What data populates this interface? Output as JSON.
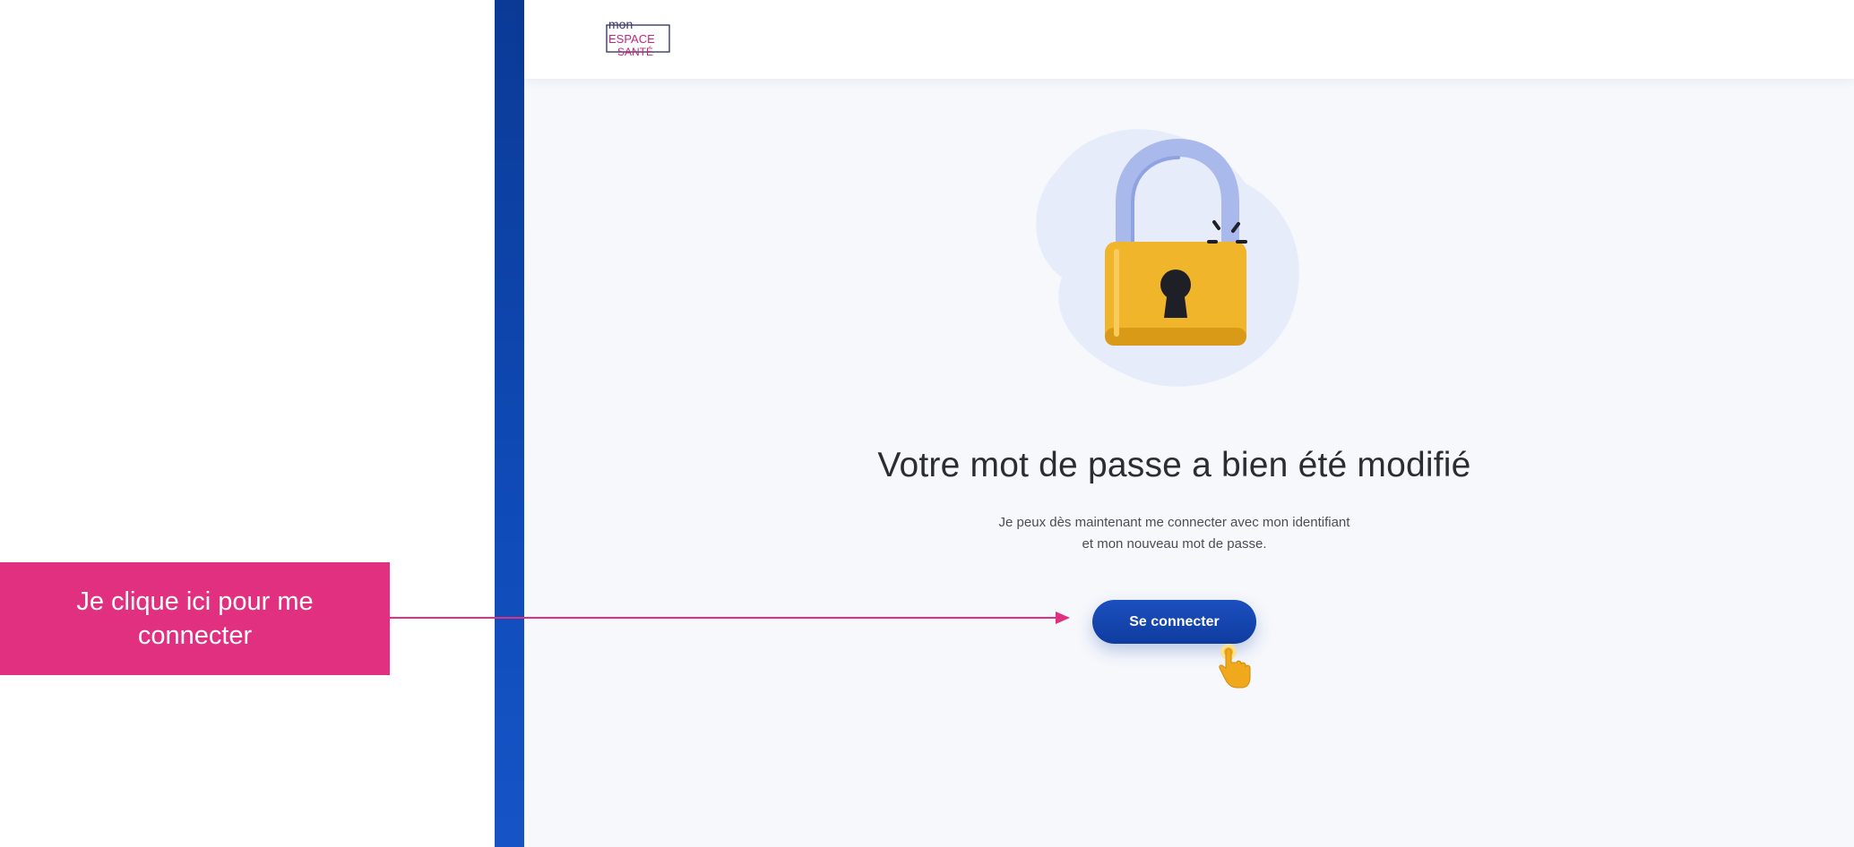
{
  "annotation": {
    "text": "Je clique ici pour me connecter",
    "color": "#e0307f"
  },
  "app": {
    "logo": {
      "lines": [
        "mon",
        "ESPACE",
        "SANTÉ"
      ]
    },
    "illustration": "padlock-unlocked-icon",
    "title": "Votre mot de passe a bien été modifié",
    "subtitle_line1": "Je peux dès maintenant me connecter avec mon identifiant",
    "subtitle_line2": "et mon nouveau mot de passe.",
    "connect_button_label": "Se connecter",
    "cursor_icon": "hand-pointer-icon",
    "colors": {
      "primary": "#0e3c9f",
      "sidebar": "#0f4bb8",
      "padlock": "#f0b52a",
      "shackle": "#9fb2e8",
      "background": "#f6f8fc"
    }
  }
}
